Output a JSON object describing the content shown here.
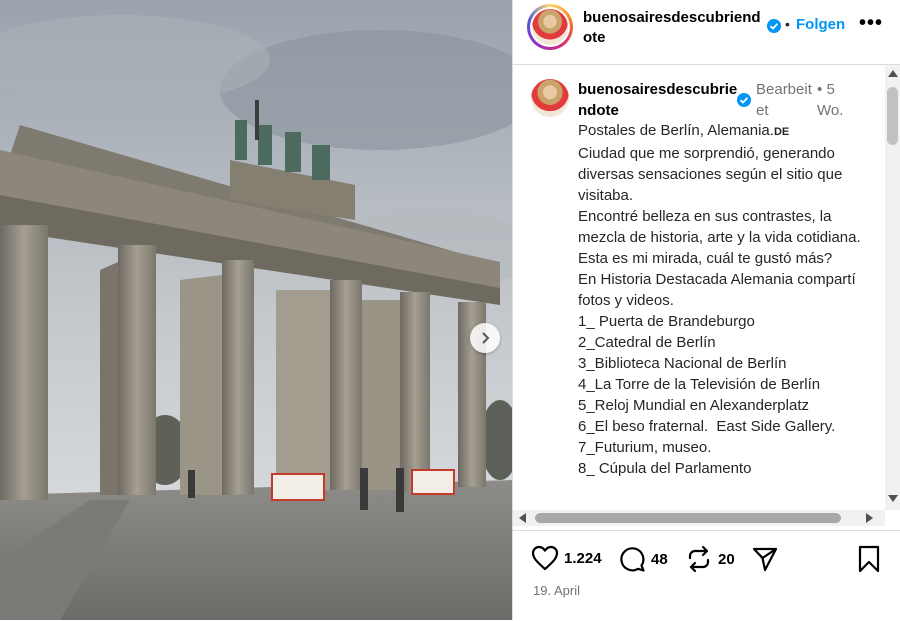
{
  "post": {
    "username_header": "buenosairesdescubriendote",
    "follow_label": "Folgen",
    "dot": "•",
    "more_label": "•••"
  },
  "caption": {
    "username": "buenosairesdescubriendote",
    "edited_label": "Bearbeitet",
    "dot": "•",
    "time": "5 Wo.",
    "lines": [
      "Postales de Berlín, Alemania.",
      "Ciudad que me sorprendió, generando diversas sensaciones según el sitio que visitaba.",
      "Encontré belleza en sus contrastes, la mezcla de historia, arte y la vida cotidiana.",
      "Esta es mi mirada, cuál te gustó más?",
      "En Historia Destacada Alemania compartí fotos y videos.",
      "",
      "1_ Puerta de Brandeburgo",
      "2_Catedral de Berlín",
      "3_Biblioteca Nacional de Berlín",
      "4_La Torre de la Televisión de Berlín",
      "5_Reloj Mundial en Alexanderplatz",
      "6_El beso fraternal.  East Side Gallery.",
      "7_Futurium, museo.",
      "8_ Cúpula del Parlamento"
    ],
    "flag_tag": "DE"
  },
  "stats": {
    "likes": "1.224",
    "comments": "48",
    "reposts": "20"
  },
  "date": "19. April",
  "colors": {
    "accent": "#0095f6",
    "muted": "#737373",
    "border": "#dbdbdb"
  },
  "icons": {
    "next": "chevron-right-icon",
    "like": "heart-icon",
    "comment": "comment-bubble-icon",
    "repost": "repost-icon",
    "share": "paper-plane-icon",
    "save": "bookmark-icon",
    "verified": "verified-badge-icon"
  }
}
